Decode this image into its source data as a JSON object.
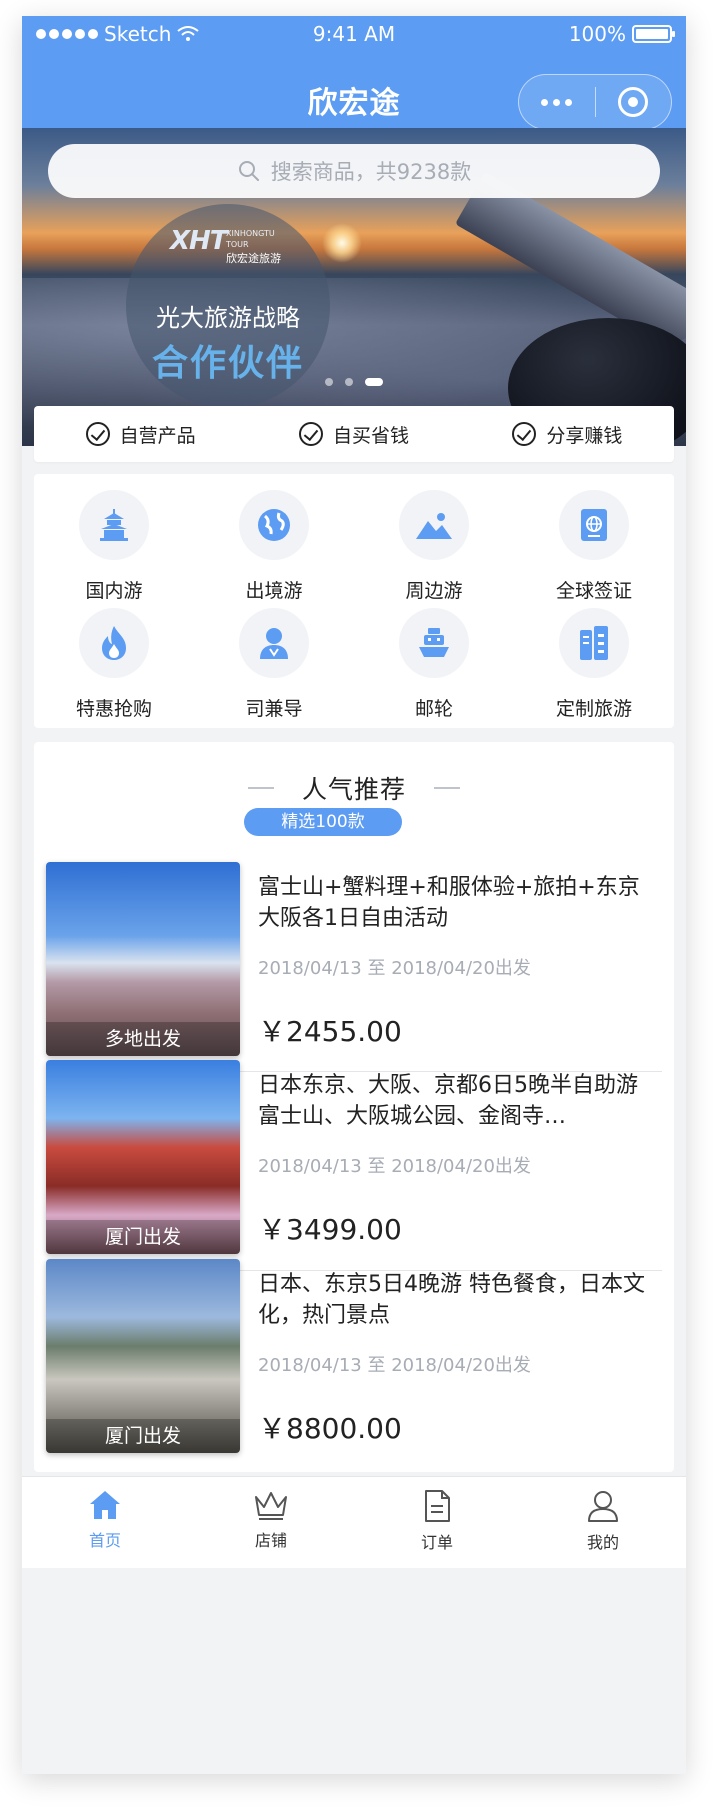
{
  "status_bar": {
    "carrier": "Sketch",
    "time": "9:41 AM",
    "battery": "100%"
  },
  "nav": {
    "title": "欣宏途"
  },
  "search": {
    "placeholder": "搜索商品，共9238款"
  },
  "banner": {
    "logo_mark": "XHT",
    "logo_en_1": "XINHONGTU",
    "logo_en_2": "TOUR",
    "logo_cn": "欣宏途旅游",
    "tagline_1": "光大旅游战略",
    "tagline_2": "合作伙伴",
    "slide_count": 3,
    "active_slide": 3
  },
  "features": [
    {
      "label": "自营产品"
    },
    {
      "label": "自买省钱"
    },
    {
      "label": "分享赚钱"
    }
  ],
  "categories": [
    {
      "label": "国内游",
      "icon": "temple-icon"
    },
    {
      "label": "出境游",
      "icon": "globe-icon"
    },
    {
      "label": "周边游",
      "icon": "landscape-icon"
    },
    {
      "label": "全球签证",
      "icon": "passport-icon"
    },
    {
      "label": "特惠抢购",
      "icon": "flame-icon"
    },
    {
      "label": "司兼导",
      "icon": "person-icon"
    },
    {
      "label": "邮轮",
      "icon": "cruise-ship-icon"
    },
    {
      "label": "定制旅游",
      "icon": "luggage-icon"
    }
  ],
  "recommend": {
    "title": "人气推荐",
    "badge": "精选100款",
    "items": [
      {
        "title": "富士山+蟹料理+和服体验+旅拍+东京大阪各1日自由活动",
        "dates": "2018/04/13 至 2018/04/20出发",
        "price": "￥2455.00",
        "departure": "多地出发"
      },
      {
        "title": "日本东京、大阪、京都6日5晚半自助游   富士山、大阪城公园、金阁寺…",
        "dates": "2018/04/13 至 2018/04/20出发",
        "price": "￥3499.00",
        "departure": "厦门出发"
      },
      {
        "title": "日本、东京5日4晚游 特色餐食，日本文化，热门景点",
        "dates": "2018/04/13 至 2018/04/20出发",
        "price": "￥8800.00",
        "departure": "厦门出发"
      }
    ]
  },
  "tabbar": [
    {
      "label": "首页",
      "icon": "home-icon",
      "active": true
    },
    {
      "label": "店铺",
      "icon": "crown-icon",
      "active": false
    },
    {
      "label": "订单",
      "icon": "document-icon",
      "active": false
    },
    {
      "label": "我的",
      "icon": "user-icon",
      "active": false
    }
  ],
  "colors": {
    "primary": "#5c9cf2",
    "text": "#222222",
    "muted": "#a7acb5",
    "background": "#f2f3f5"
  }
}
